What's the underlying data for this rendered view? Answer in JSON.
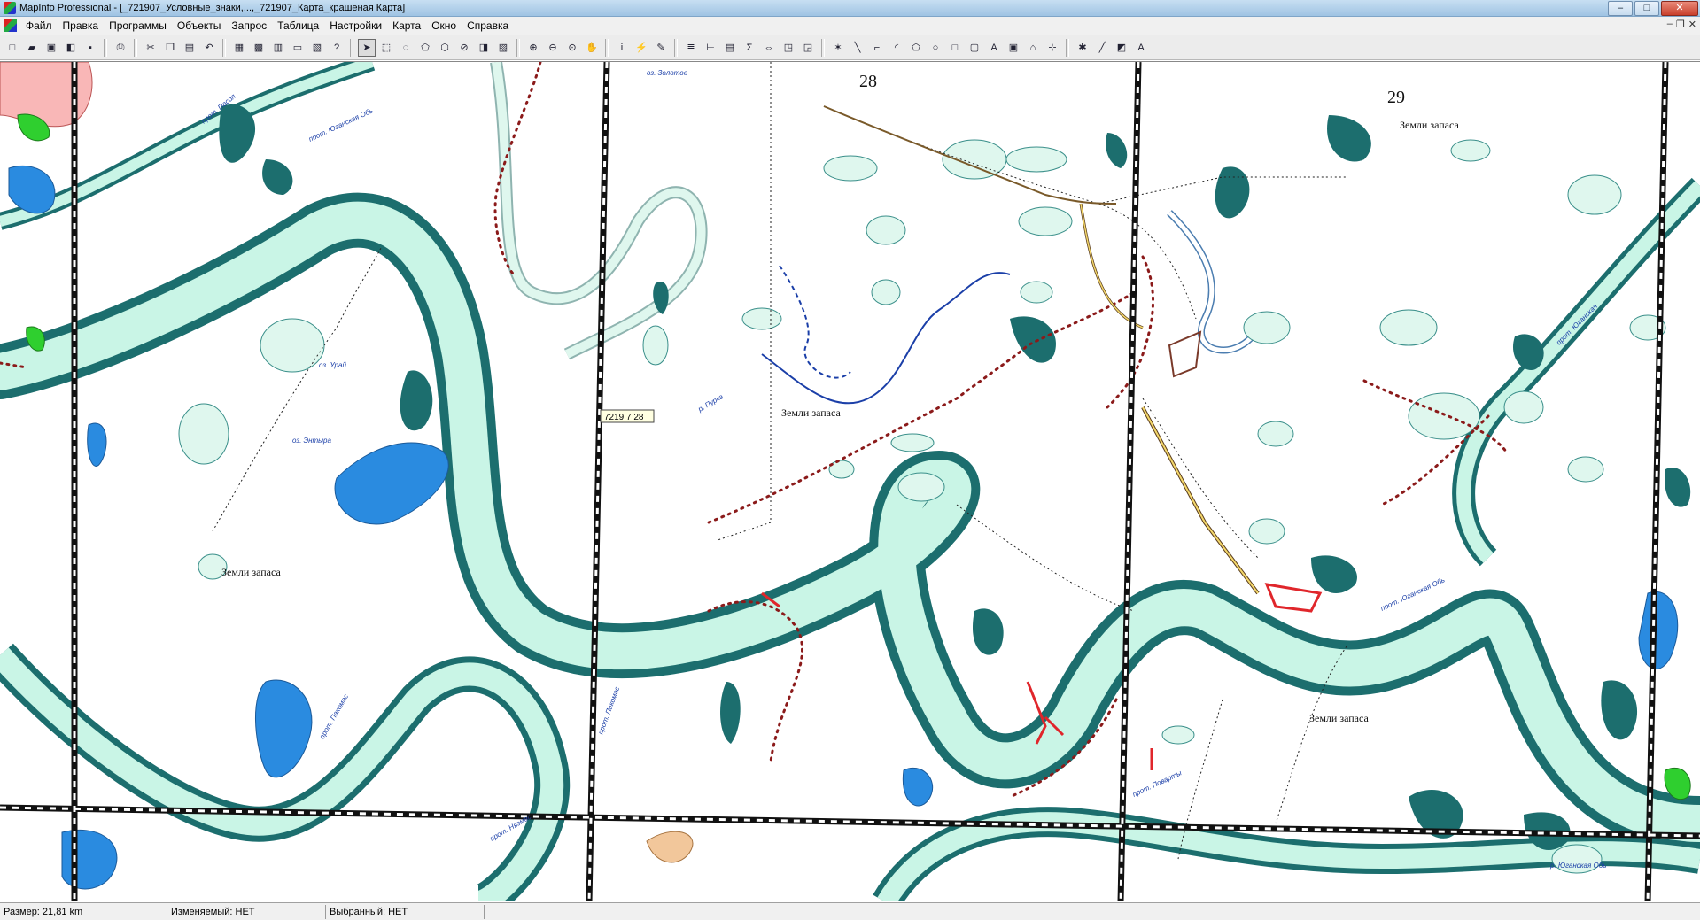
{
  "window": {
    "title": "MapInfo Professional - [_721907_Условные_знаки,...,_721907_Карта_крашеная Карта]",
    "min_glyph": "–",
    "max_glyph": "□",
    "close_glyph": "✕"
  },
  "menu": {
    "items": [
      "Файл",
      "Правка",
      "Программы",
      "Объекты",
      "Запрос",
      "Таблица",
      "Настройки",
      "Карта",
      "Окно",
      "Справка"
    ],
    "mdi_min": "–",
    "mdi_restore": "❐",
    "mdi_close": "✕"
  },
  "toolbar": {
    "buttons": [
      {
        "icon": "new-document-icon",
        "glyph": "□"
      },
      {
        "icon": "open-folder-icon",
        "glyph": "▰"
      },
      {
        "icon": "open-workspace-icon",
        "glyph": "▣"
      },
      {
        "icon": "open-dbms-icon",
        "glyph": "◧"
      },
      {
        "icon": "save-icon",
        "glyph": "▪"
      },
      {
        "sep": true
      },
      {
        "icon": "print-icon",
        "glyph": "⎙"
      },
      {
        "sep": true
      },
      {
        "icon": "cut-icon",
        "glyph": "✂"
      },
      {
        "icon": "copy-icon",
        "glyph": "❐"
      },
      {
        "icon": "paste-icon",
        "glyph": "▤"
      },
      {
        "icon": "undo-icon",
        "glyph": "↶"
      },
      {
        "sep": true
      },
      {
        "icon": "new-browser-icon",
        "glyph": "▦"
      },
      {
        "icon": "new-mapper-icon",
        "glyph": "▩"
      },
      {
        "icon": "new-grapher-icon",
        "glyph": "▥"
      },
      {
        "icon": "new-layout-icon",
        "glyph": "▭"
      },
      {
        "icon": "redistrict-icon",
        "glyph": "▧"
      },
      {
        "icon": "help-pointer-icon",
        "glyph": "?"
      },
      {
        "sep": true
      },
      {
        "icon": "select-arrow-icon",
        "glyph": "➤",
        "active": true
      },
      {
        "icon": "marquee-select-icon",
        "glyph": "⬚"
      },
      {
        "icon": "radius-select-icon",
        "glyph": "◌"
      },
      {
        "icon": "polygon-select-icon",
        "glyph": "⬠"
      },
      {
        "icon": "boundary-select-icon",
        "glyph": "⬡"
      },
      {
        "icon": "unselect-icon",
        "glyph": "⊘"
      },
      {
        "icon": "invert-selection-icon",
        "glyph": "◨"
      },
      {
        "icon": "graph-select-icon",
        "glyph": "▨"
      },
      {
        "sep": true
      },
      {
        "icon": "zoom-in-icon",
        "glyph": "⊕"
      },
      {
        "icon": "zoom-out-icon",
        "glyph": "⊖"
      },
      {
        "icon": "change-view-icon",
        "glyph": "⊙"
      },
      {
        "icon": "grabber-hand-icon",
        "glyph": "✋"
      },
      {
        "sep": true
      },
      {
        "icon": "info-tool-icon",
        "glyph": "i"
      },
      {
        "icon": "hotlink-icon",
        "glyph": "⚡"
      },
      {
        "icon": "label-tool-icon",
        "glyph": "✎"
      },
      {
        "sep": true
      },
      {
        "icon": "layer-control-icon",
        "glyph": "≣"
      },
      {
        "icon": "ruler-icon",
        "glyph": "⊢"
      },
      {
        "icon": "legend-icon",
        "glyph": "▤"
      },
      {
        "icon": "statistics-icon",
        "glyph": "Σ"
      },
      {
        "icon": "drag-map-icon",
        "glyph": "⇔"
      },
      {
        "icon": "clip-region-icon",
        "glyph": "◳"
      },
      {
        "icon": "set-target-icon",
        "glyph": "◲"
      },
      {
        "sep": true
      },
      {
        "icon": "symbol-tool-icon",
        "glyph": "✶"
      },
      {
        "icon": "line-tool-icon",
        "glyph": "╲"
      },
      {
        "icon": "polyline-tool-icon",
        "glyph": "⌐"
      },
      {
        "icon": "arc-tool-icon",
        "glyph": "◜"
      },
      {
        "icon": "polygon-tool-icon",
        "glyph": "⬠"
      },
      {
        "icon": "ellipse-tool-icon",
        "glyph": "○"
      },
      {
        "icon": "rectangle-tool-icon",
        "glyph": "□"
      },
      {
        "icon": "rounded-rect-tool-icon",
        "glyph": "▢"
      },
      {
        "icon": "text-tool-icon",
        "glyph": "A"
      },
      {
        "icon": "frame-tool-icon",
        "glyph": "▣"
      },
      {
        "icon": "reshape-icon",
        "glyph": "⌂"
      },
      {
        "icon": "add-node-icon",
        "glyph": "⊹"
      },
      {
        "sep": true
      },
      {
        "icon": "symbol-style-icon",
        "glyph": "✱"
      },
      {
        "icon": "line-style-icon",
        "glyph": "╱"
      },
      {
        "icon": "region-style-icon",
        "glyph": "◩"
      },
      {
        "icon": "text-style-icon",
        "glyph": "A"
      }
    ]
  },
  "map": {
    "labels": {
      "zemli1": "Земли запаса",
      "zemli2": "Земли запаса",
      "zemli3": "Земли запаса",
      "zemli4": "Земли запаса",
      "sheet28": "28",
      "sheet29": "29",
      "tooltip": "7219 7  28"
    },
    "small_labels": [
      "прот. Юганская Обь",
      "прот. Пасол",
      "оз. Урай",
      "оз. Энтыра",
      "прот. Пакомас",
      "прот. Няэмас",
      "р. Пуркэ",
      "оз. Золотое",
      "прот. Юганская Обь",
      "прот. Юганская",
      "прот. Поварты",
      "прот. Пакомас",
      "р. Юганская Обь"
    ],
    "colors": {
      "river": "#c9f5e6",
      "bank": "#1c6e6e",
      "lake": "#dff7ee",
      "blue_lake": "#2a8be0",
      "route": "#8b1a1a",
      "grid": "#111111"
    }
  },
  "status": {
    "size": "Размер: 21,81 km",
    "editable": "Изменяемый: НЕТ",
    "selected": "Выбранный: НЕТ"
  }
}
